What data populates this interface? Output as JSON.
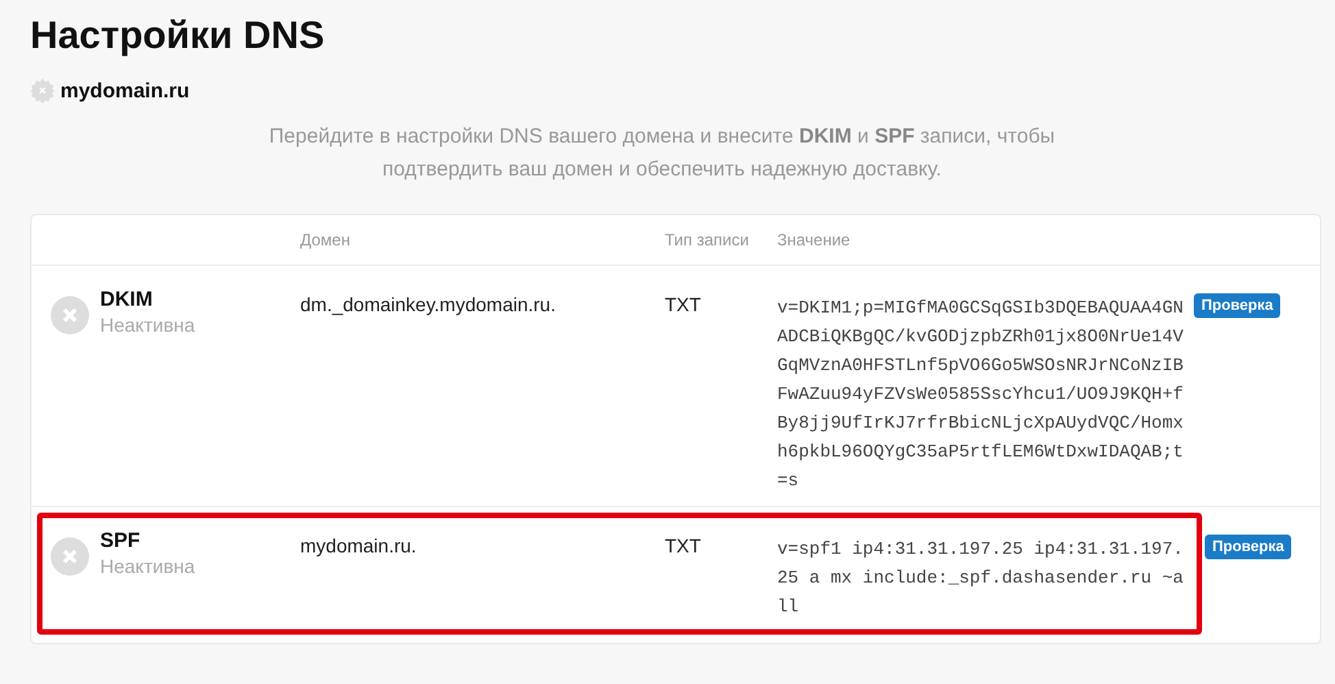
{
  "page": {
    "title": "Настройки DNS",
    "domain": "mydomain.ru",
    "description": "Перейдите в настройки DNS вашего домена и внесите **DKIM** и **SPF** записи, чтобы подтвердить ваш домен и обеспечить надежную доставку."
  },
  "table": {
    "columns": [
      "Домен",
      "Тип записи",
      "Значение"
    ],
    "rows": [
      {
        "name": "DKIM",
        "status": "Неактивна",
        "active": false,
        "domain": "dm._domainkey.mydomain.ru.",
        "type": "TXT",
        "value": "v=DKIM1;p=MIGfMA0GCSqGSIb3DQEBAQUAA4GNADCBiQKBgQC/kvGODjzpbZRh01jx8O0NrUe14VGqMVznA0HFSTLnf5pVO6Go5WSOsNRJrNCoNzIBFwAZuu94yFZVsWe0585SscYhcu1/UO9J9KQH+fBy8jj9UfIrKJ7rfrBbicNLjcXpAUydVQC/Homxh6pkbL96OQYgC35aP5rtfLEM6WtDxwIDAQAB;t=s",
        "button": "Проверка",
        "highlighted": false
      },
      {
        "name": "SPF",
        "status": "Неактивна",
        "active": false,
        "domain": "mydomain.ru.",
        "type": "TXT",
        "value": "v=spf1 ip4:31.31.197.25 ip4:31.31.197.25 a mx include:_spf.dashasender.ru ~all",
        "button": "Проверка",
        "highlighted": true
      }
    ]
  }
}
